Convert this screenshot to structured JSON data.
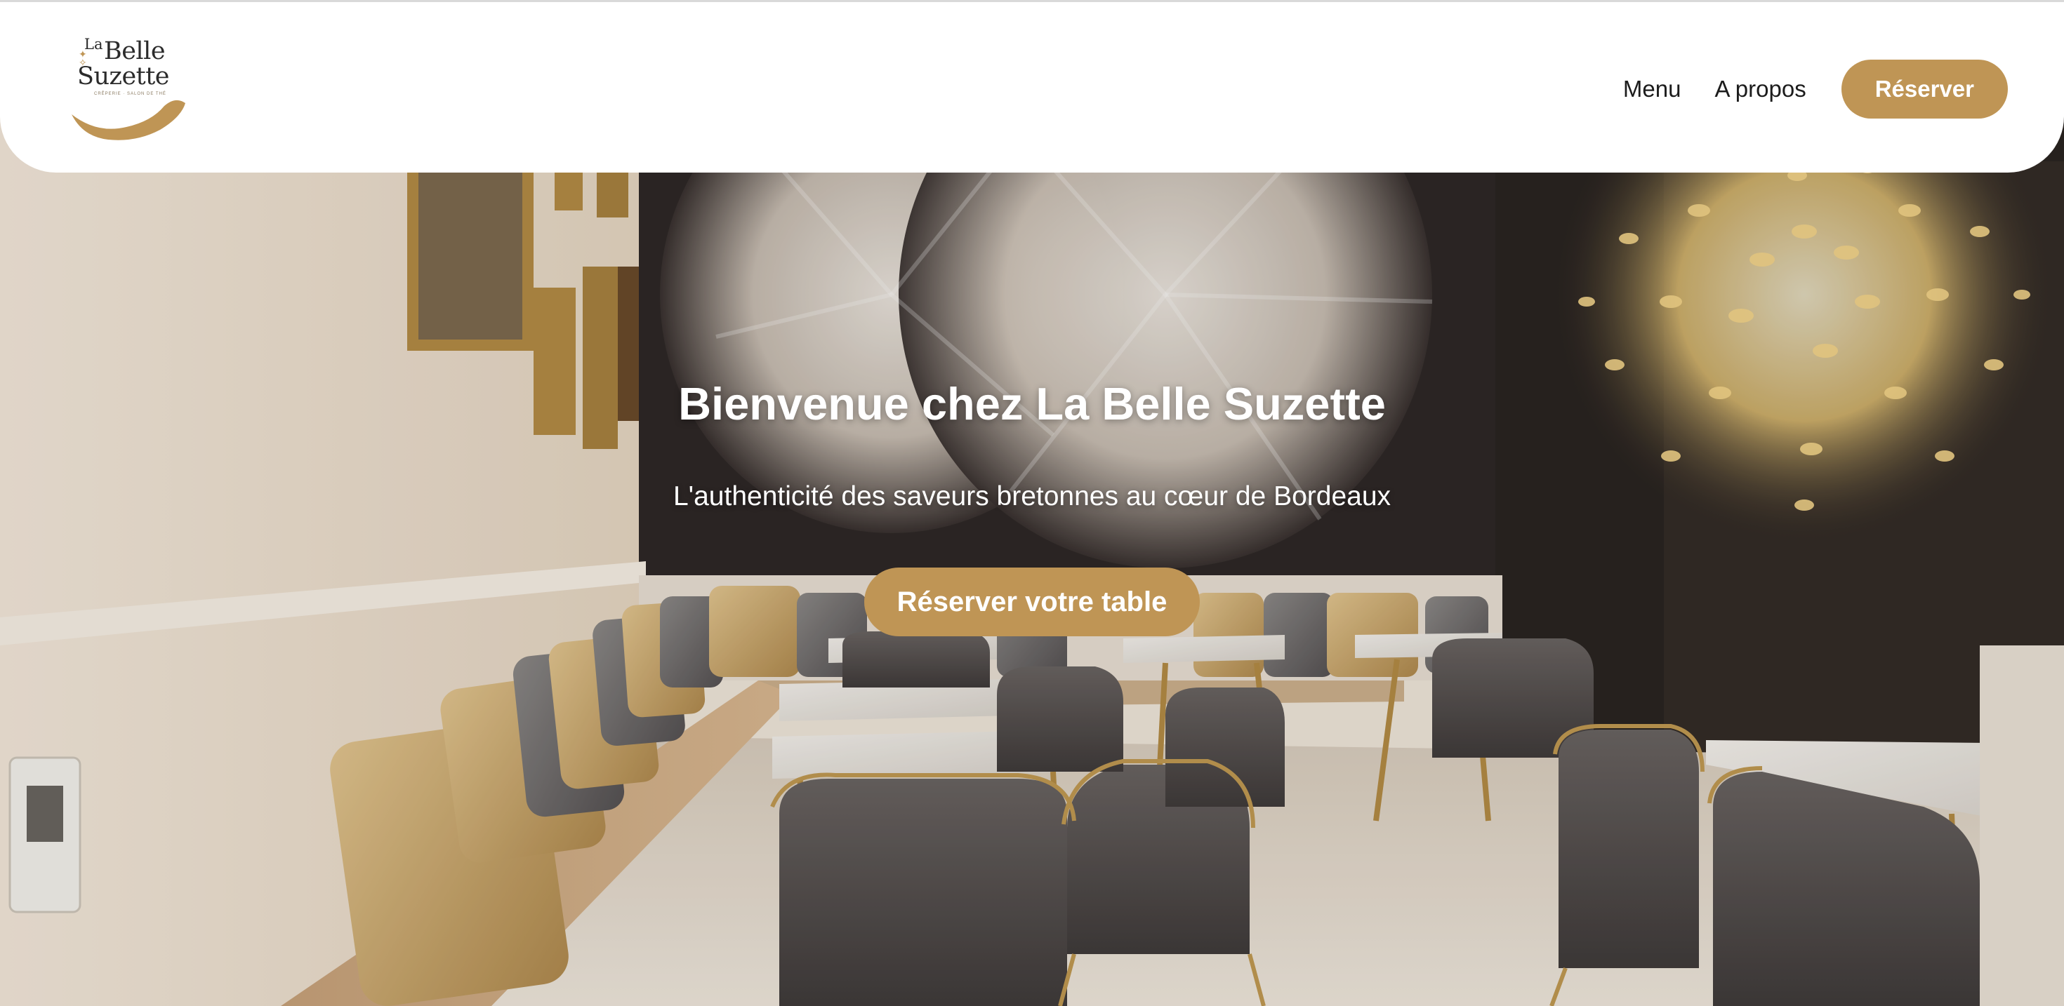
{
  "brand": {
    "logo_la": "La",
    "logo_belle": "Belle",
    "logo_suzette": "Suzette",
    "logo_tagline": "CRÊPERIE · SALON DE THÉ",
    "accent_color": "#bf9555"
  },
  "nav": {
    "items": [
      {
        "label": "Menu"
      },
      {
        "label": "A propos"
      }
    ],
    "cta_label": "Réserver"
  },
  "hero": {
    "title": "Bienvenue chez La Belle Suzette",
    "subtitle": "L'authenticité des saveurs bretonnes au cœur de Bordeaux",
    "cta_label": "Réserver votre table",
    "background_image": "restaurant-interior-photo"
  }
}
